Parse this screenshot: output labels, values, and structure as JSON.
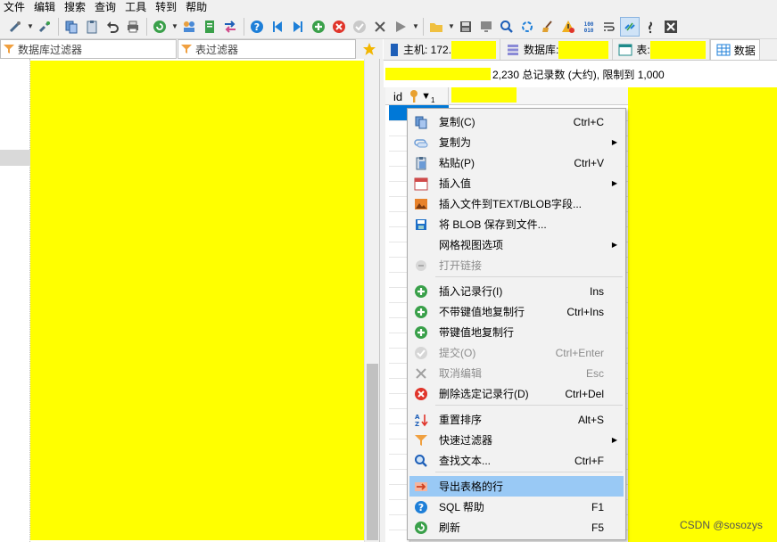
{
  "menubar": {
    "items": [
      {
        "label": "文件"
      },
      {
        "label": "编辑"
      },
      {
        "label": "搜索"
      },
      {
        "label": "查询"
      },
      {
        "label": "工具"
      },
      {
        "label": "转到"
      },
      {
        "label": "帮助"
      }
    ]
  },
  "toolbar": {
    "icons": [
      "connect-icon",
      "disconnect-icon",
      "copy-icon",
      "paste-icon",
      "undo-icon",
      "print-icon",
      "refresh-icon",
      "user-manager-icon",
      "export-icon",
      "transfer-icon",
      "help-icon",
      "first-icon",
      "last-icon",
      "add-icon",
      "delete-icon",
      "check-icon",
      "cancel-icon",
      "run-icon",
      "folder-icon",
      "save-icon",
      "monitor-icon",
      "search-icon",
      "replace-icon",
      "clean-icon",
      "warning-icon",
      "binary-icon",
      "wrap-icon",
      "link-icon",
      "more-icon",
      "close-icon"
    ]
  },
  "filters": {
    "db_filter_placeholder": "数据库过滤器",
    "table_filter_placeholder": "表过滤器"
  },
  "tabs": [
    {
      "label": "主机: 172.",
      "icon": "host-icon"
    },
    {
      "label": "数据库:",
      "icon": "database-icon"
    },
    {
      "label": "表:",
      "icon": "table-icon"
    },
    {
      "label": "数据",
      "icon": "grid-icon",
      "active": true
    }
  ],
  "info": {
    "text": "2,230 总记录数 (大约), 限制到 1,000"
  },
  "grid": {
    "column_id": "id",
    "sort_indicator": "▼",
    "sort_order": "1"
  },
  "context_menu": {
    "items": [
      {
        "label": "复制(C)",
        "shortcut": "Ctrl+C",
        "icon": "copy-icon"
      },
      {
        "label": "复制为",
        "submenu": true,
        "icon": "copy-as-icon"
      },
      {
        "label": "粘贴(P)",
        "shortcut": "Ctrl+V",
        "icon": "paste-icon"
      },
      {
        "label": "插入值",
        "submenu": true,
        "icon": "calendar-icon"
      },
      {
        "label": "插入文件到TEXT/BLOB字段...",
        "icon": "image-file-icon"
      },
      {
        "label": "将 BLOB 保存到文件...",
        "icon": "save-icon"
      },
      {
        "label": "网格视图选项",
        "submenu": true,
        "icon": ""
      },
      {
        "label": "打开链接",
        "disabled": true,
        "icon": "link-icon"
      },
      {
        "label": "插入记录行(I)",
        "shortcut": "Ins",
        "icon": "add-icon"
      },
      {
        "label": "不带键值地复制行",
        "shortcut": "Ctrl+Ins",
        "icon": "add-icon"
      },
      {
        "label": "带键值地复制行",
        "icon": "add-icon"
      },
      {
        "label": "提交(O)",
        "shortcut": "Ctrl+Enter",
        "disabled": true,
        "icon": "check-icon"
      },
      {
        "label": "取消编辑",
        "shortcut": "Esc",
        "disabled": true,
        "icon": "cancel-icon"
      },
      {
        "label": "删除选定记录行(D)",
        "shortcut": "Ctrl+Del",
        "icon": "delete-icon"
      },
      {
        "label": "重置排序",
        "shortcut": "Alt+S",
        "icon": "sort-az-icon"
      },
      {
        "label": "快速过滤器",
        "submenu": true,
        "icon": "filter-icon"
      },
      {
        "label": "查找文本...",
        "shortcut": "Ctrl+F",
        "icon": "search-icon"
      },
      {
        "label": "导出表格的行",
        "icon": "export-rows-icon",
        "highlighted": true
      },
      {
        "label": "SQL 帮助",
        "shortcut": "F1",
        "icon": "help-icon"
      },
      {
        "label": "刷新",
        "shortcut": "F5",
        "icon": "refresh-icon"
      }
    ]
  },
  "watermark": "CSDN @sosozys",
  "colors": {
    "redaction": "#ffff00",
    "highlight": "#99c9f5",
    "selection": "#0078d7",
    "green": "#3aa04a",
    "red": "#e0352b",
    "blue": "#1e7fd8"
  }
}
